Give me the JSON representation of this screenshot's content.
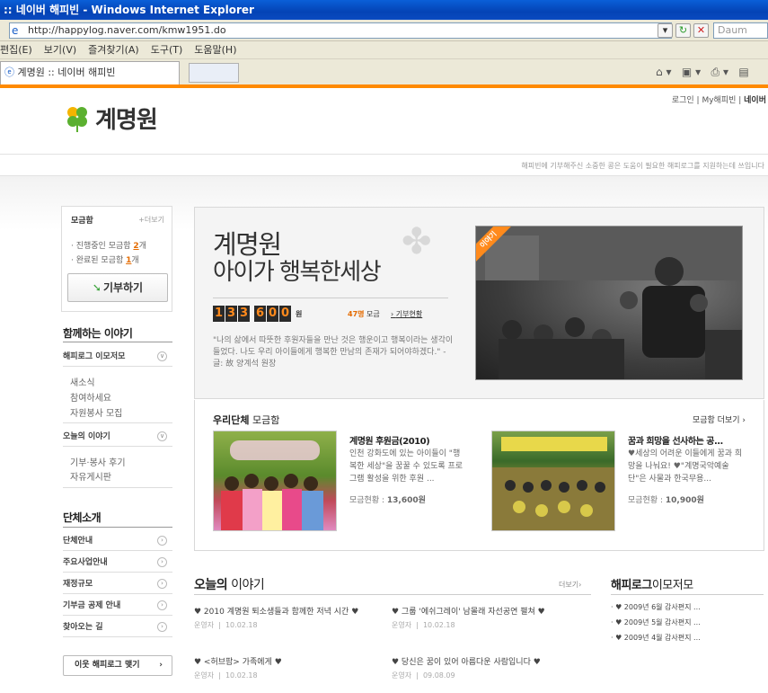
{
  "browser": {
    "title": ":: 네이버 해피빈 - Windows Internet Explorer",
    "url": "http://happylog.naver.com/kmw1951.do",
    "search_placeholder": "Daum",
    "menu": [
      "편집(E)",
      "보기(V)",
      "즐겨찾기(A)",
      "도구(T)",
      "도움말(H)"
    ],
    "tab_label": "계명원 :: 네이버 해피빈"
  },
  "header": {
    "links": [
      "로그인",
      "My해피빈",
      "네이버"
    ],
    "logo": "계명원",
    "tagline": "해피빈에 기부해주신 소중한 콩은 도움이 필요한 해피로그를 지원하는데 쓰입니다"
  },
  "sidebar": {
    "fund_title": "모금함",
    "fund_more": "+더보기",
    "ongoing_label": "· 진행중인 모금함",
    "ongoing_count": "2",
    "completed_label": "· 완료된 모금함",
    "completed_count": "1",
    "count_suffix": "개",
    "donate_button": "기부하기",
    "together_title": "함께하는 이야기",
    "together_items": [
      {
        "label": "해피로그 이모저모",
        "subs": [
          "새소식",
          "참여하세요",
          "자원봉사 모집"
        ]
      },
      {
        "label": "오늘의 이야기",
        "subs": [
          "기부·봉사 후기",
          "자유게시판"
        ]
      }
    ],
    "org_title": "단체소개",
    "org_items": [
      "단체안내",
      "주요사업안내",
      "재정규모",
      "기부금 공제 안내",
      "찾아오는 길"
    ],
    "neighbor_button": "이웃 해피로그 맺기"
  },
  "hero": {
    "title1": "계명원",
    "title2": "아이가 행복한세상",
    "amount_digits": [
      "1",
      "3",
      "3",
      "6",
      "0",
      "0"
    ],
    "amount_unit": "원",
    "donor_count": "47명",
    "donor_label": "모금",
    "status_link": "기부현황",
    "quote": "\"나의 삶에서 따뜻한 후원자들을 만난 것은 행운이고 행복이라는 생각이 들었다. 나도 우리 아이들에게 행복한 만남의 존재가 되어야하겠다.\" -글: 故 양계석 원장",
    "photo_badge": "이야기"
  },
  "group": {
    "title_bold": "우리단체",
    "title_rest": "모금함",
    "more": "모금함 더보기 ›",
    "items": [
      {
        "name": "계명원 후원금(2010)",
        "desc": "인천 강화도에 있는 아이들이 \"행복한 세상\"을 꿈꿀 수 있도록 프로그램 활성을 위한 후원 ...",
        "stat_label": "모금현황 :",
        "stat_value": "13,600원"
      },
      {
        "name": "꿈과 희망을 선사하는 공...",
        "desc": "♥세상의 어려운 이들에게 꿈과 희망을 나눠요! ♥\"계명국악예술단\"은 사물과 한국무용...",
        "stat_label": "모금현황 :",
        "stat_value": "10,900원"
      }
    ]
  },
  "stories": {
    "title_bold": "오늘의",
    "title_rest": "이야기",
    "more": "더보기›",
    "items": [
      {
        "title": "♥ 2010 계명원 퇴소생들과 함께한 저녁 시간 ♥",
        "author": "운영자",
        "date": "10.02.18"
      },
      {
        "title": "♥ 그룹 '에쉬그레이' 남몰래 자선공연 펼쳐 ♥",
        "author": "운영자",
        "date": "10.02.18"
      },
      {
        "title": "♥ <허브팜> 가족에게 ♥",
        "author": "운영자",
        "date": "10.02.18"
      },
      {
        "title": "♥ 당신은 꿈이 있어 아름다운 사람입니다 ♥",
        "author": "운영자",
        "date": "09.08.09"
      }
    ]
  },
  "happylog_news": {
    "title_bold": "해피로그",
    "title_rest": "이모저모",
    "items": [
      "· ♥ 2009년 6월 감사편지 ...",
      "· ♥ 2009년 5월 감사편지 ...",
      "· ♥ 2009년 4월 감사편지 ..."
    ]
  },
  "colors": {
    "accent": "#ff8a00",
    "clover": "#3aa33a",
    "title_bar": "#0a5fd8"
  }
}
